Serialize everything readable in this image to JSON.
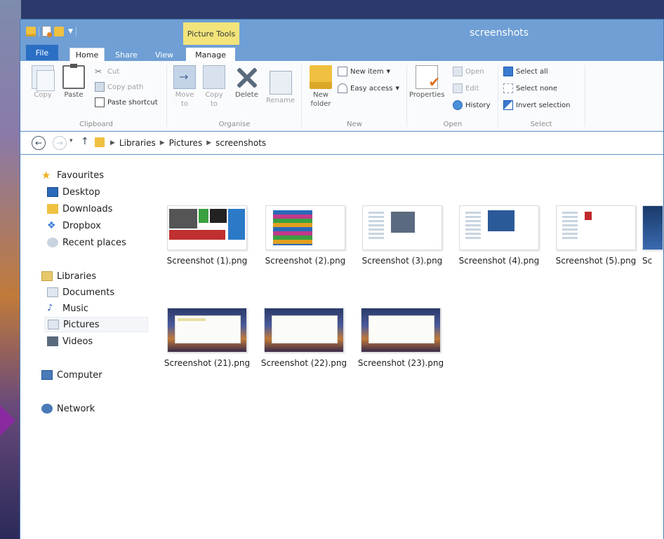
{
  "window": {
    "title": "screenshots",
    "context_tab": "Picture Tools"
  },
  "tabs": {
    "file": "File",
    "home": "Home",
    "share": "Share",
    "view": "View",
    "manage": "Manage"
  },
  "ribbon": {
    "clipboard": {
      "copy": "Copy",
      "paste": "Paste",
      "cut": "Cut",
      "copy_path": "Copy path",
      "paste_shortcut": "Paste shortcut",
      "label": "Clipboard"
    },
    "organise": {
      "move_to": "Move to",
      "copy_to": "Copy to",
      "delete": "Delete",
      "rename": "Rename",
      "label": "Organise"
    },
    "new": {
      "new_folder": "New folder",
      "new_item": "New item",
      "easy_access": "Easy access",
      "label": "New"
    },
    "open": {
      "properties": "Properties",
      "open": "Open",
      "edit": "Edit",
      "history": "History",
      "label": "Open"
    },
    "select": {
      "select_all": "Select all",
      "select_none": "Select none",
      "invert_selection": "Invert selection",
      "label": "Select"
    }
  },
  "address": {
    "crumbs": [
      "Libraries",
      "Pictures",
      "screenshots"
    ]
  },
  "nav": {
    "favourites": "Favourites",
    "desktop": "Desktop",
    "downloads": "Downloads",
    "dropbox": "Dropbox",
    "recent_places": "Recent places",
    "libraries": "Libraries",
    "documents": "Documents",
    "music": "Music",
    "pictures": "Pictures",
    "videos": "Videos",
    "computer": "Computer",
    "network": "Network"
  },
  "files": [
    "Screenshot (1).png",
    "Screenshot (2).png",
    "Screenshot (3).png",
    "Screenshot (4).png",
    "Screenshot (5).png",
    "Sc",
    "Screenshot (21).png",
    "Screenshot (22).png",
    "Screenshot (23).png"
  ],
  "colors": {
    "titlebar": "#6f9fd4",
    "file_tab": "#2b6fc4",
    "context_tab": "#f2e47a"
  }
}
